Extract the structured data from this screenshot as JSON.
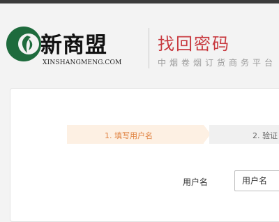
{
  "header": {
    "brand_name": "新商盟",
    "brand_domain": "XINSHANGMENG.COM",
    "page_title": "找回密码",
    "tagline": "中烟卷烟订货商务平台"
  },
  "steps": [
    {
      "label": "1. 填写用户名",
      "state": "active"
    },
    {
      "label": "2. 验证",
      "state": "inactive"
    }
  ],
  "form": {
    "username_label": "用户名",
    "username_placeholder": "用户名",
    "username_value": ""
  },
  "colors": {
    "brand_green": "#1e6b3d",
    "title_red": "#c8393f",
    "step_active_bg": "#fdf0e3",
    "step_active_text": "#e0813f",
    "topbar": "#3b3b3b"
  }
}
